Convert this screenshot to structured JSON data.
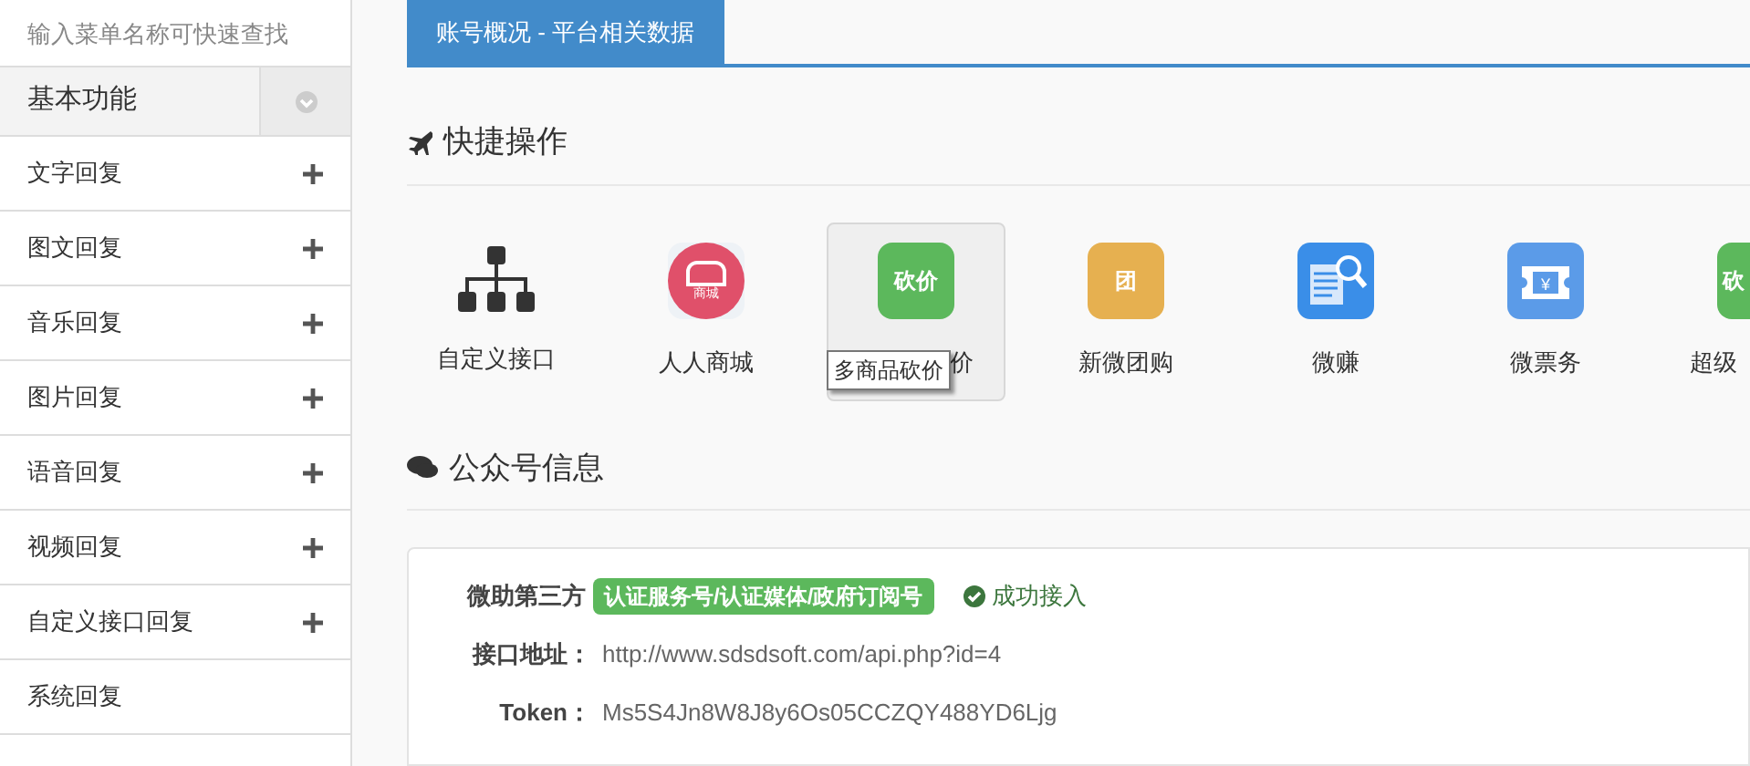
{
  "sidebar": {
    "search": {
      "placeholder": "输入菜单名称可快速查找"
    },
    "group": {
      "title": "基本功能",
      "expanded": true
    },
    "items": [
      {
        "label": "文字回复",
        "expandable": true
      },
      {
        "label": "图文回复",
        "expandable": true
      },
      {
        "label": "音乐回复",
        "expandable": true
      },
      {
        "label": "图片回复",
        "expandable": true
      },
      {
        "label": "语音回复",
        "expandable": true
      },
      {
        "label": "视频回复",
        "expandable": true
      },
      {
        "label": "自定义接口回复",
        "expandable": true
      },
      {
        "label": "系统回复",
        "expandable": false
      }
    ]
  },
  "tab": {
    "label": "账号概况 - 平台相关数据"
  },
  "quick_actions": {
    "title": "快捷操作",
    "items": [
      {
        "kind": "sitemap",
        "label": "自定义接口",
        "selected": false
      },
      {
        "kind": "shop",
        "label": "人人商城",
        "icon_text": "商城",
        "selected": false
      },
      {
        "kind": "badge",
        "label": "价",
        "icon_text": "砍价",
        "color": "#5cb85c",
        "selected": true
      },
      {
        "kind": "badge",
        "label": "新微团购",
        "icon_text": "团",
        "color": "#e6b050",
        "selected": false
      },
      {
        "kind": "search-doc",
        "label": "微赚",
        "selected": false
      },
      {
        "kind": "ticket",
        "label": "微票务",
        "icon_text": "¥",
        "selected": false
      },
      {
        "kind": "badge",
        "label": "超级",
        "icon_text": "砍",
        "color": "#5cb85c",
        "selected": false
      }
    ],
    "tooltip": "多商品砍价"
  },
  "account_info": {
    "title": "公众号信息",
    "name": "微助第三方",
    "type_badge": "认证服务号/认证媒体/政府订阅号",
    "status": "成功接入",
    "fields": [
      {
        "label": "接口地址：",
        "value": "http://www.sdsdsoft.com/api.php?id=4"
      },
      {
        "label": "Token：",
        "value": "Ms5S4Jn8W8J8y6Os05CCZQY488YD6Ljg"
      }
    ]
  }
}
